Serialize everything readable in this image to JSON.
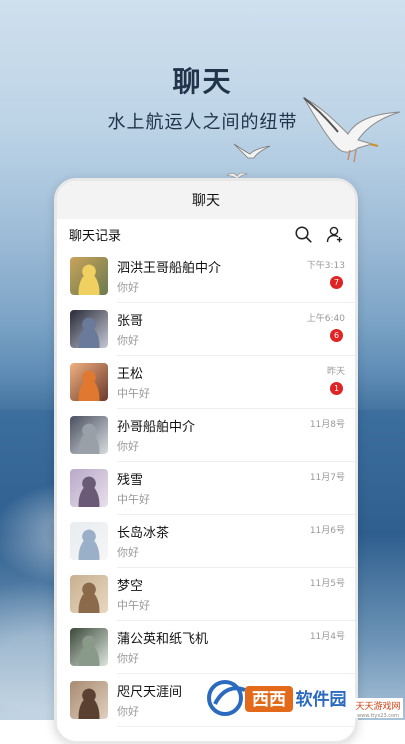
{
  "hero": {
    "title": "聊天",
    "subtitle": "水上航运人之间的纽带"
  },
  "app": {
    "title": "聊天",
    "section_label": "聊天记录",
    "icons": {
      "search": "search-icon",
      "add_contact": "add-contact-icon"
    }
  },
  "chats": [
    {
      "name": "泗洪王哥船舶中介",
      "msg": "你好",
      "time": "下午3:13",
      "badge": "7",
      "avatar": [
        "#c9a35a",
        "#f0d060",
        "#6a7a50"
      ]
    },
    {
      "name": "张哥",
      "msg": "你好",
      "time": "上午6:40",
      "badge": "6",
      "avatar": [
        "#2a2a3a",
        "#6a7a9a",
        "#c4c8d4"
      ]
    },
    {
      "name": "王松",
      "msg": "中午好",
      "time": "昨天",
      "badge": "1",
      "avatar": [
        "#f0b080",
        "#e07830",
        "#6a3a2a"
      ]
    },
    {
      "name": "孙哥船舶中介",
      "msg": "你好",
      "time": "11月8号",
      "badge": "",
      "avatar": [
        "#4a5060",
        "#9aa0a8",
        "#d8dce0"
      ]
    },
    {
      "name": "残雪",
      "msg": "中午好",
      "time": "11月7号",
      "badge": "",
      "avatar": [
        "#b8a8c8",
        "#6a5a78",
        "#e8e0ea"
      ]
    },
    {
      "name": "长岛冰茶",
      "msg": "你好",
      "time": "11月6号",
      "badge": "",
      "avatar": [
        "#e8ecf0",
        "#9ab0c8",
        "#f6f6f6"
      ]
    },
    {
      "name": "梦空",
      "msg": "中午好",
      "time": "11月5号",
      "badge": "",
      "avatar": [
        "#c8b090",
        "#8a6a4a",
        "#e8d8c0"
      ]
    },
    {
      "name": "蒲公英和纸飞机",
      "msg": "你好",
      "time": "11月4号",
      "badge": "",
      "avatar": [
        "#3a4a3a",
        "#8a9a8a",
        "#dde4dd"
      ]
    },
    {
      "name": "咫尺天涯间",
      "msg": "你好",
      "time": "",
      "badge": "",
      "avatar": [
        "#a88a70",
        "#5a4030",
        "#e0d0c0"
      ]
    }
  ],
  "watermark": {
    "brand": "西西软件园",
    "site_cn": "天天游戏网",
    "site_url": "www.ttyx23.com"
  }
}
